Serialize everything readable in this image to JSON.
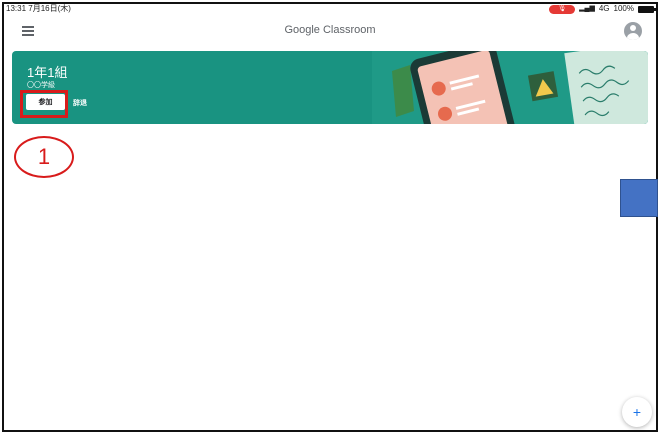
{
  "statusbar": {
    "time": "13:31  7月16日(木)",
    "signal": "4G",
    "battery": "100%"
  },
  "appbar": {
    "title": "Google Classroom",
    "menu_icon": "hamburger-menu-icon",
    "account_icon": "account-circle-icon"
  },
  "class_card": {
    "title": "1年1組",
    "subtitle": "〇〇学級",
    "join_label": "参加",
    "decline_label": "辞退",
    "background_color": "#199381"
  },
  "annotation": {
    "step_number": "1",
    "highlight_color": "#d81b1b"
  },
  "fab": {
    "label": "+"
  }
}
